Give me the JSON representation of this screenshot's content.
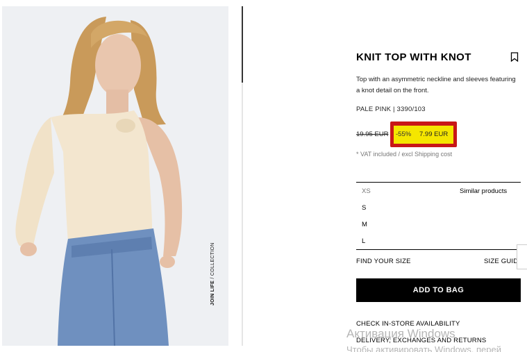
{
  "gallery": {
    "caption_bold": "JOIN LIFE",
    "caption_rest": " / COLLECTION"
  },
  "product": {
    "title": "KNIT TOP WITH KNOT",
    "description": "Top with an asymmetric neckline and sleeves featuring a knot detail on the front.",
    "color_ref": "PALE PINK | 3390/103",
    "old_price": "19.95 EUR",
    "discount": "-55%",
    "price": "7.99 EUR",
    "vat_note": "* VAT included / excl Shipping cost"
  },
  "sizes": [
    "XS",
    "S",
    "M",
    "L"
  ],
  "similar_label": "Similar products",
  "find_size_label": "FIND YOUR SIZE",
  "size_guide_label": "SIZE GUIDE",
  "add_to_bag_label": "ADD TO BAG",
  "links": {
    "check_store": "CHECK IN-STORE AVAILABILITY",
    "delivery": "DELIVERY, EXCHANGES AND RETURNS"
  },
  "watermark": {
    "line1": "Активация Windows",
    "line2": "Чтобы активировать Windows, перей"
  },
  "icons": {
    "bookmark": "bookmark-icon"
  },
  "colors": {
    "highlight_border": "#c81818",
    "highlight_fill": "#f5e600",
    "button_bg": "#000000"
  }
}
